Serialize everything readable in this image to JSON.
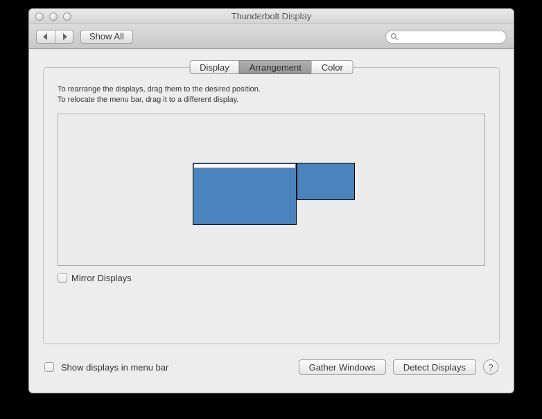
{
  "window": {
    "title": "Thunderbolt Display"
  },
  "toolbar": {
    "show_all_label": "Show All",
    "search_placeholder": ""
  },
  "tabs": [
    {
      "label": "Display",
      "active": false
    },
    {
      "label": "Arrangement",
      "active": true
    },
    {
      "label": "Color",
      "active": false
    }
  ],
  "panel": {
    "instruction_line1": "To rearrange the displays, drag them to the desired position.",
    "instruction_line2": "To relocate the menu bar, drag it to a different display.",
    "mirror_label": "Mirror Displays"
  },
  "footer": {
    "show_in_menubar_label": "Show displays in menu bar",
    "gather_windows_label": "Gather Windows",
    "detect_displays_label": "Detect Displays"
  }
}
